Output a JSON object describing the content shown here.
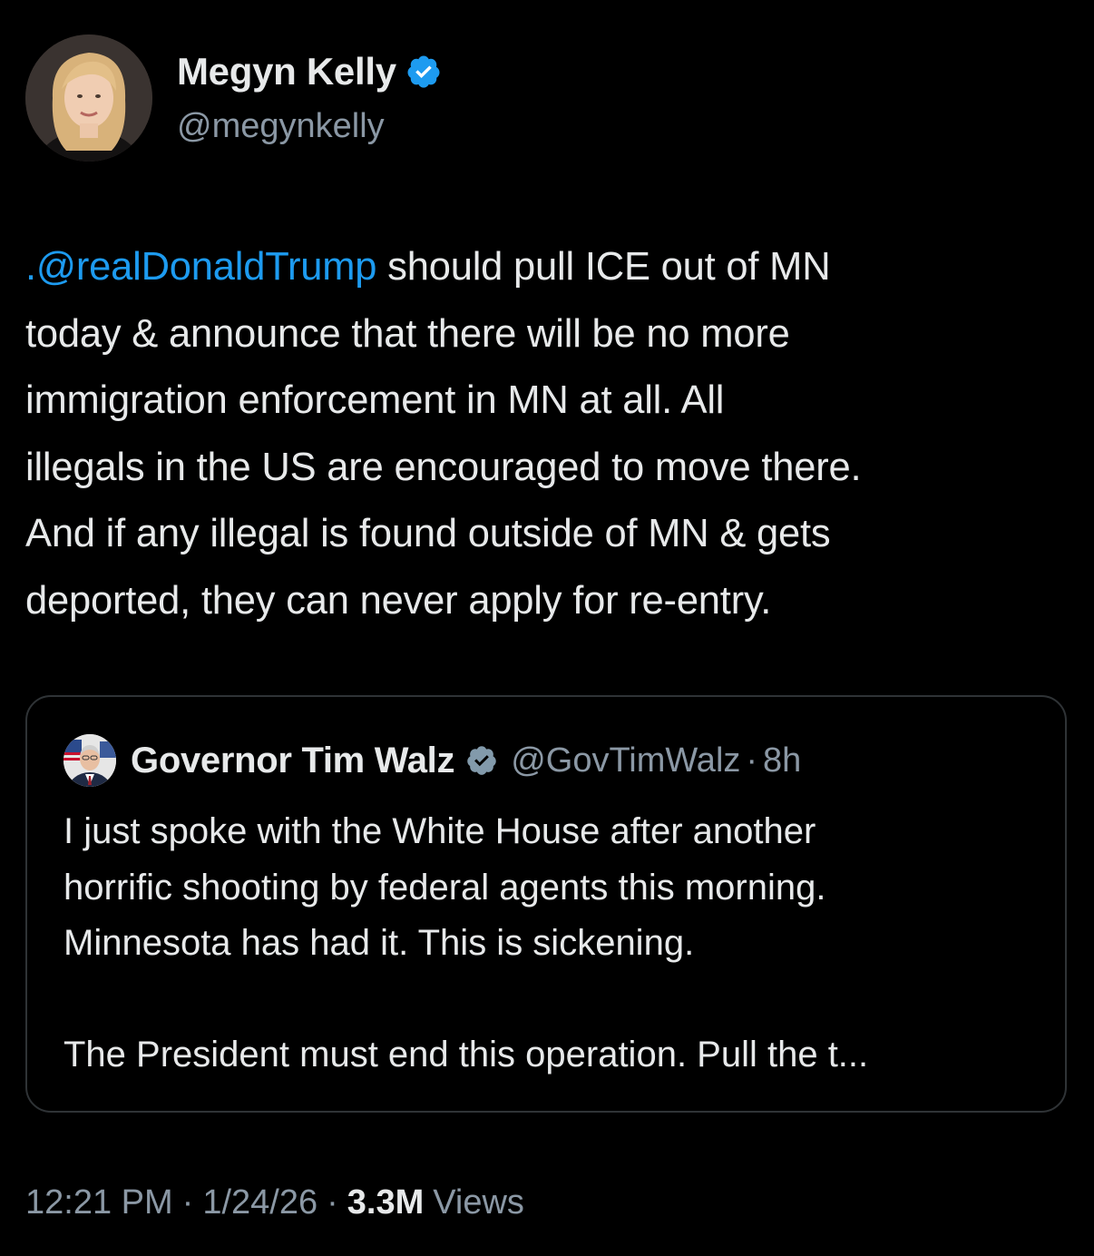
{
  "author": {
    "name": "Megyn Kelly",
    "handle": "@megynkelly",
    "verified": true,
    "avatar_icon": "profile-photo"
  },
  "tweet": {
    "mention": ".@realDonaldTrump",
    "line1_rest": " should pull ICE out of MN",
    "line2": "today & announce that there will be no more",
    "line3": "immigration enforcement in MN at all. All",
    "line4": "illegals in the US are encouraged to move there.",
    "line5": "And if any illegal is found outside of MN & gets",
    "line6": "deported, they can never apply for re-entry."
  },
  "quoted_tweet": {
    "name": "Governor Tim Walz",
    "handle": "@GovTimWalz",
    "separator": "·",
    "time": "8h",
    "verified": true,
    "avatar_icon": "profile-photo",
    "line1": "I just spoke with the White House after another",
    "line2": "horrific shooting by federal agents this morning.",
    "line3": "Minnesota has had it. This is sickening.",
    "line4": "The President must end this operation. Pull the t..."
  },
  "meta": {
    "time": "12:21 PM",
    "separator": "·",
    "date": "1/24/26",
    "views_count": "3.3M",
    "views_label": "Views"
  },
  "colors": {
    "background": "#000000",
    "text": "#e7e9ea",
    "secondary": "#8b98a5",
    "accent": "#1d9bf0",
    "border": "#2f3336"
  }
}
